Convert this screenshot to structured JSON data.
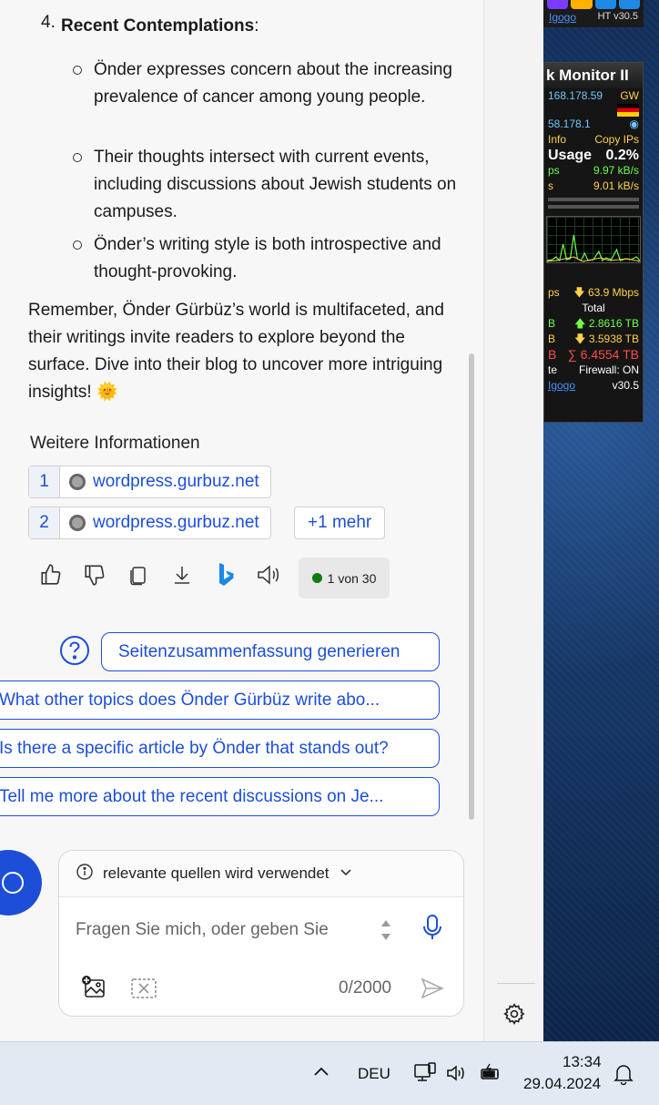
{
  "widget_top": {
    "link": "Igogo",
    "version": "HT v30.5"
  },
  "netmon": {
    "title": "k Monitor II",
    "ip1": "168.178.59",
    "gw": "GW",
    "ip2": "58.178.1",
    "info": "Info",
    "copy": "Copy IPs",
    "usage_label": "Usage",
    "usage_value": "0.2%",
    "rate1": "9.97 kB/s",
    "rate2": "9.01 kB/s",
    "speed": "63.9 Mbps",
    "total_label": "Total",
    "up_total": "2.8616 TB",
    "down_total": "3.5938 TB",
    "sum_total": "6.4554 TB",
    "firewall": "Firewall: ON",
    "link": "Igogo",
    "version": "v30.5",
    "prefix_ps": "ps",
    "prefix_b1": "B",
    "prefix_b2": "B",
    "prefix_b3": "B",
    "prefix_te": "te"
  },
  "content": {
    "list_item_4_number": "4.",
    "list_item_4_title": "Recent Contemplations",
    "list_item_4_colon": ":",
    "bullets": [
      "Önder expresses concern about the increasing prevalence of cancer among young people.",
      "Their thoughts intersect with current events, including discussions about Jewish students on campuses.",
      "Önder’s writing style is both introspective and thought-provoking."
    ],
    "closing": "Remember, Önder Gürbüz’s world is multifaceted, and their writings invite readers to explore beyond the surface. Dive into their blog to uncover more intriguing insights! 🌞"
  },
  "sources": {
    "heading": "Weitere Informationen",
    "items": [
      {
        "num": "1",
        "label": "wordpress.gurbuz.net"
      },
      {
        "num": "2",
        "label": "wordpress.gurbuz.net"
      }
    ],
    "more": "+1 mehr"
  },
  "response_counter": "1 von 30",
  "suggestions": [
    "Seitenzusammenfassung generieren",
    "What other topics does Önder Gürbüz write abo...",
    "Is there a specific article by Önder that stands out?",
    "Tell me more about the recent discussions on Je..."
  ],
  "input": {
    "source_mode": "relevante quellen wird verwendet",
    "placeholder": "Fragen Sie mich, oder geben Sie",
    "char_count": "0/2000"
  },
  "taskbar": {
    "language": "DEU",
    "time": "13:34",
    "date": "29.04.2024"
  },
  "colors": {
    "accent": "#1c4ed8",
    "taskbar": "#e2e9f3"
  }
}
